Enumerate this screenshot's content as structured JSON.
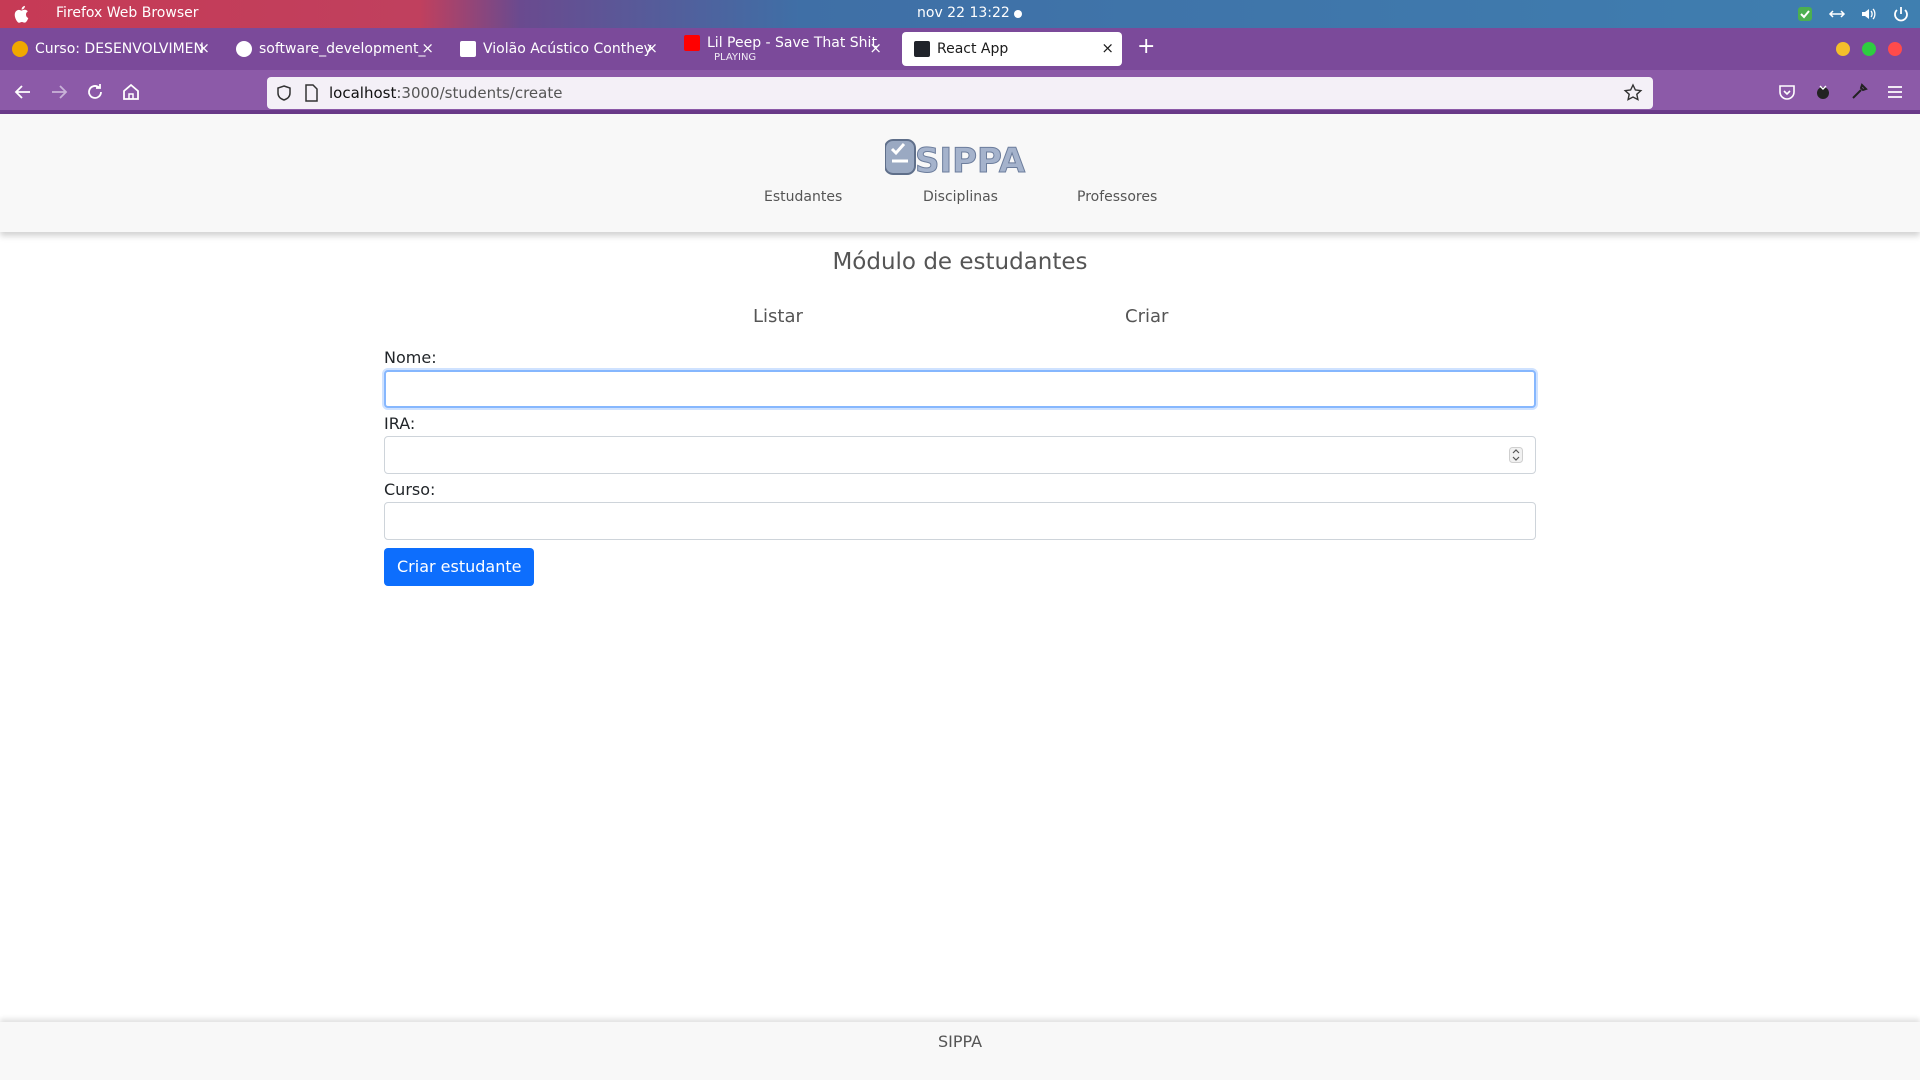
{
  "os": {
    "app_name": "Firefox Web Browser",
    "clock": "nov 22  13:22"
  },
  "browser": {
    "tabs": [
      {
        "title": "Curso: DESENVOLVIMEN",
        "favicon_color": "#f0a800"
      },
      {
        "title": "software_development_",
        "favicon_color": "#ffffff"
      },
      {
        "title": "Violão Acústico Conthey",
        "favicon_color": "#ffffff"
      },
      {
        "title": "Lil Peep - Save That Shit (",
        "subtitle": "PLAYING",
        "favicon_color": "#ff0000"
      },
      {
        "title": "React App",
        "favicon_color": "#20232a"
      }
    ],
    "active_tab_index": 4,
    "url_host": "localhost",
    "url_rest": ":3000/students/create"
  },
  "site": {
    "logo_text": "SIPPA",
    "nav": [
      "Estudantes",
      "Disciplinas",
      "Professores"
    ]
  },
  "module": {
    "title": "Módulo de estudantes",
    "subnav": [
      "Listar",
      "Criar"
    ]
  },
  "form": {
    "name_label": "Nome:",
    "name_value": "",
    "ira_label": "IRA:",
    "ira_value": "",
    "course_label": "Curso:",
    "course_value": "",
    "submit_label": "Criar estudante"
  },
  "footer": {
    "text": "SIPPA"
  },
  "colors": {
    "primary": "#0d6efd",
    "browser_chrome": "#8c5aa8"
  }
}
